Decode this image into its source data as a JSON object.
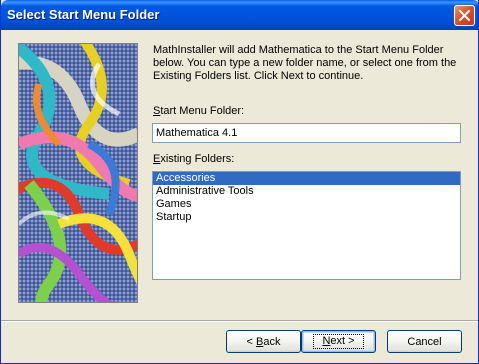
{
  "window": {
    "title": "Select Start Menu Folder"
  },
  "intro_text": "MathInstaller will add Mathematica to the Start Menu Folder below.  You can type a new folder name, or select one from the Existing Folders list.  Click Next to continue.",
  "start_menu_folder": {
    "label_accel": "S",
    "label_rest": "tart Menu Folder:",
    "value": "Mathematica 4.1"
  },
  "existing_folders": {
    "label_accel": "E",
    "label_rest": "xisting Folders:",
    "items": [
      "Accessories",
      "Administrative Tools",
      "Games",
      "Startup"
    ],
    "selected_index": 0
  },
  "buttons": {
    "back_prefix": "< ",
    "back_accel": "B",
    "back_rest": "ack",
    "next_accel": "N",
    "next_rest": "ext >",
    "cancel": "Cancel"
  },
  "icons": {
    "close": "close-x-icon"
  },
  "colors": {
    "titlebar": "#0054e3",
    "selection": "#316ac5",
    "dialog_bg": "#ece9d8"
  }
}
